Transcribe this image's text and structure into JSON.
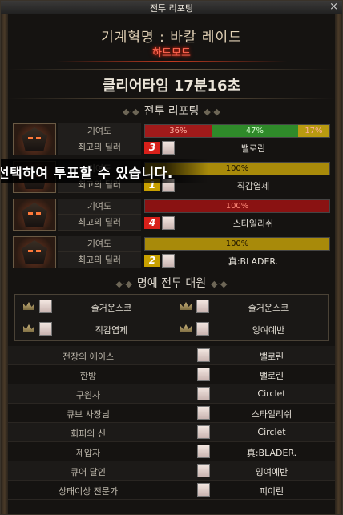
{
  "window": {
    "title": "전투 리포팅",
    "close": "×"
  },
  "header": {
    "raid_title": "기계혁명 : 바칼 레이드",
    "difficulty": "하드모드",
    "clear_time": "클리어타임  17분16초"
  },
  "report_section": {
    "title": "전투 리포팅"
  },
  "labels": {
    "contribution": "기여도",
    "best_dealer": "최고의 딜러"
  },
  "parties": [
    {
      "contribution": [
        {
          "text": "36%",
          "value": 36,
          "color": "#a01a1a"
        },
        {
          "text": "47%",
          "value": 47,
          "color": "#2f8a2a"
        },
        {
          "text": "17%",
          "value": 17,
          "color": "#b89a10"
        }
      ],
      "rank": "3",
      "rank_color": "#d8201a",
      "dealer": "밸로린"
    },
    {
      "contribution": [
        {
          "text": "100%",
          "value": 100,
          "color": "#a88a0a"
        }
      ],
      "rank": "1",
      "rank_color": "#c8a000",
      "dealer": "직감엽제"
    },
    {
      "contribution": [
        {
          "text": "100%",
          "value": 100,
          "color": "#8a1212"
        }
      ],
      "rank": "4",
      "rank_color": "#d8201a",
      "dealer": "스타일리쉬"
    },
    {
      "contribution": [
        {
          "text": "100%",
          "value": 100,
          "color": "#a88a0a"
        }
      ],
      "rank": "2",
      "rank_color": "#c8a000",
      "dealer": "真:BLADER."
    }
  ],
  "vote_banner": "선택하여 투표할 수 있습니다.",
  "honor_section": {
    "title": "명예 전투 대원",
    "members": [
      "즐거운스코",
      "즐거운스코",
      "직감엽제",
      "잉여예반"
    ]
  },
  "awards": [
    {
      "title": "전장의 에이스",
      "player": "밸로린"
    },
    {
      "title": "한방",
      "player": "밸로린"
    },
    {
      "title": "구원자",
      "player": "Circlet"
    },
    {
      "title": "큐브 사장님",
      "player": "스타일리쉬"
    },
    {
      "title": "회피의 신",
      "player": "Circlet"
    },
    {
      "title": "제압자",
      "player": "真:BLADER."
    },
    {
      "title": "큐어 달인",
      "player": "잉여예반"
    },
    {
      "title": "상태이상 전문가",
      "player": "피이린"
    }
  ]
}
